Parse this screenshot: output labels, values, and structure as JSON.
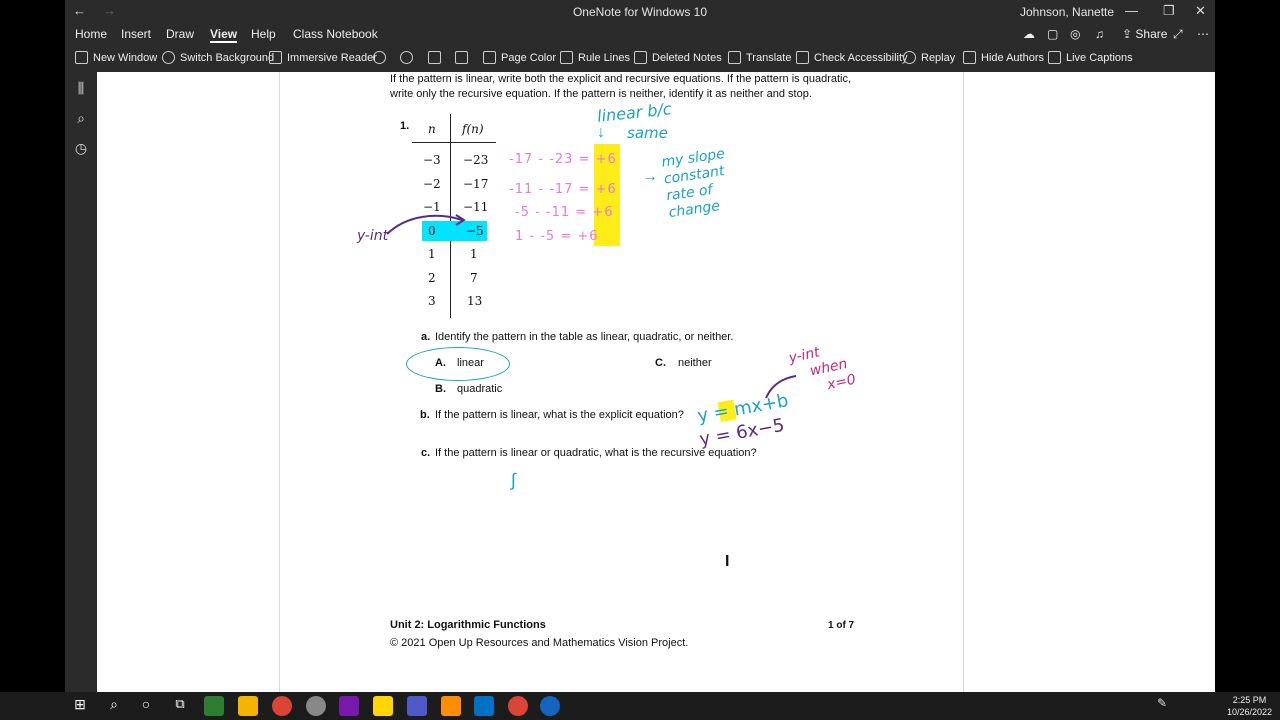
{
  "window": {
    "title": "OneNote for Windows 10",
    "user": "Johnson, Nanette",
    "share_label": "Share"
  },
  "tabs": [
    "Home",
    "Insert",
    "Draw",
    "View",
    "Help",
    "Class Notebook"
  ],
  "toolbar": [
    "New Window",
    "Switch Background",
    "Immersive Reader",
    "Page Color",
    "Rule Lines",
    "Deleted Notes",
    "Translate",
    "Check Accessibility",
    "Replay",
    "Hide Authors",
    "Live Captions"
  ],
  "instructions": [
    "If the pattern is linear, write both the explicit and recursive equations. If the pattern is quadratic,",
    "write only the recursive equation. If the pattern is neither, identify it as neither and stop."
  ],
  "problem_number": "1.",
  "table": {
    "headers": [
      "n",
      "f(n)"
    ],
    "rows": [
      [
        "−3",
        "−23"
      ],
      [
        "−2",
        "−17"
      ],
      [
        "−1",
        "−11"
      ],
      [
        "0",
        "−5"
      ],
      [
        "1",
        "1"
      ],
      [
        "2",
        "7"
      ],
      [
        "3",
        "13"
      ]
    ]
  },
  "questions": {
    "a": {
      "letter": "a.",
      "text": "Identify the pattern in the table as linear, quadratic, or neither."
    },
    "options": [
      {
        "letter": "A.",
        "label": "linear"
      },
      {
        "letter": "B.",
        "label": "quadratic"
      },
      {
        "letter": "C.",
        "label": "neither"
      }
    ],
    "b": {
      "letter": "b.",
      "text": "If the pattern is linear, what is the explicit equation?"
    },
    "c": {
      "letter": "c.",
      "text": "If the pattern is linear or quadratic, what is the recursive equation?"
    }
  },
  "footer": {
    "unit": "Unit 2: Logarithmic Functions",
    "page": "1 of 7",
    "copyright": "© 2021 Open Up Resources and Mathematics Vision Project."
  },
  "ink": {
    "linear_note_1": "linear b/c",
    "linear_note_2": "same",
    "slope_note": [
      "my slope",
      "constant",
      "rate of",
      "change"
    ],
    "differences": [
      "-17 - -23 = +6",
      "-11 - -17 = +6",
      "-5 - -11 = +6",
      "1 - -5 = +6"
    ],
    "y_int_label": "y-int",
    "y_int_when": [
      "y-int",
      "when",
      "x=0"
    ],
    "equation_1": "y = mx+b",
    "equation_2": "y = 6x−5"
  },
  "clock": {
    "time": "2:25 PM",
    "date": "10/26/2022"
  },
  "colors": {
    "chrome": "#2b2b2b",
    "taskbar": "#1c1c1c",
    "ink_pink": "#e87ad8",
    "ink_teal": "#1aa3c4",
    "ink_purple": "#5a2a8a",
    "highlight_yellow": "#ffeb00",
    "highlight_cyan": "#00e5ff",
    "ink_magenta": "#c0287a"
  }
}
